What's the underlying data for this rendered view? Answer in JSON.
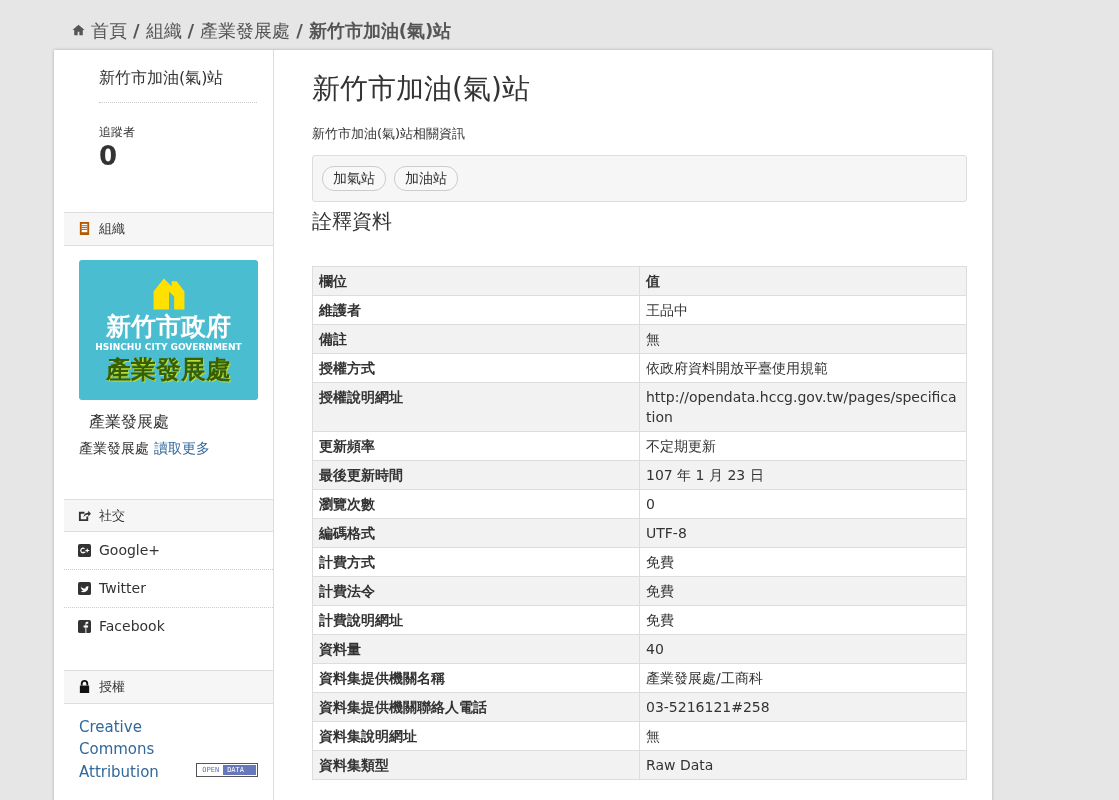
{
  "breadcrumb": {
    "separator": "/",
    "items": [
      {
        "label": "首頁",
        "kind": "home"
      },
      {
        "label": "組織",
        "kind": "link"
      },
      {
        "label": "產業發展處",
        "kind": "link"
      },
      {
        "label": "新竹市加油(氣)站",
        "kind": "current"
      }
    ]
  },
  "sidebar": {
    "title": "新竹市加油(氣)站",
    "followers_label": "追蹤者",
    "followers_count": "0",
    "organization": {
      "heading": "組織",
      "logo": {
        "title": "新竹市政府",
        "subtitle": "HSINCHU CITY GOVERNMENT",
        "unit": "產業發展處"
      },
      "name": "產業發展處",
      "description": "產業發展處",
      "read_more": "讀取更多"
    },
    "social": {
      "heading": "社交",
      "items": [
        {
          "label": "Google+",
          "kind": "googleplus"
        },
        {
          "label": "Twitter",
          "kind": "twitter"
        },
        {
          "label": "Facebook",
          "kind": "facebook"
        }
      ]
    },
    "license": {
      "heading": "授權",
      "link_line_1": "Creative Commons",
      "link_line_2": "Attribution",
      "badge_left": "OPEN",
      "badge_right": "DATA"
    }
  },
  "dataset": {
    "title": "新竹市加油(氣)站",
    "description": "新竹市加油(氣)站相關資訊",
    "tags": [
      "加氣站",
      "加油站"
    ],
    "metadata_heading": "詮釋資料",
    "table": {
      "columns": [
        "欄位",
        "值"
      ],
      "rows": [
        [
          "維護者",
          "王品中"
        ],
        [
          "備註",
          "無"
        ],
        [
          "授權方式",
          "依政府資料開放平臺使用規範"
        ],
        [
          "授權說明網址",
          "http://opendata.hccg.gov.tw/pages/specification"
        ],
        [
          "更新頻率",
          "不定期更新"
        ],
        [
          "最後更新時間",
          "107 年 1 月 23 日"
        ],
        [
          "瀏覽次數",
          "0"
        ],
        [
          "編碼格式",
          "UTF-8"
        ],
        [
          "計費方式",
          "免費"
        ],
        [
          "計費法令",
          "免費"
        ],
        [
          "計費說明網址",
          "免費"
        ],
        [
          "資料量",
          "40"
        ],
        [
          "資料集提供機關名稱",
          "產業發展處/工商科"
        ],
        [
          "資料集提供機關聯絡人電話",
          "03-5216121#258"
        ],
        [
          "資料集說明網址",
          "無"
        ],
        [
          "資料集類型",
          "Raw Data"
        ]
      ]
    }
  }
}
